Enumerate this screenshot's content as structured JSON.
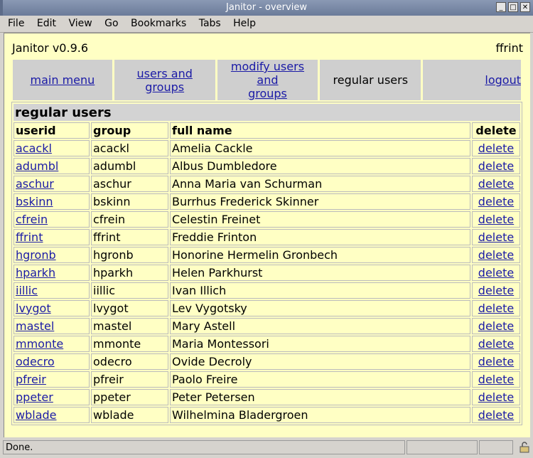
{
  "window": {
    "title": "Janitor - overview"
  },
  "menu": [
    "File",
    "Edit",
    "View",
    "Go",
    "Bookmarks",
    "Tabs",
    "Help"
  ],
  "app": {
    "name": "Janitor v0.9.6",
    "user": "ffrint"
  },
  "nav": {
    "main_menu": "main menu",
    "users_groups": "users and groups",
    "modify_line1": "modify users and",
    "modify_line2": "groups",
    "current": "regular users",
    "logout": "logout"
  },
  "table": {
    "title": "regular users",
    "headers": {
      "userid": "userid",
      "group": "group",
      "fullname": "full name",
      "delete": "delete"
    },
    "delete_label": "delete",
    "rows": [
      [
        "acackl",
        "acackl",
        "Amelia Cackle"
      ],
      [
        "adumbl",
        "adumbl",
        "Albus Dumbledore"
      ],
      [
        "aschur",
        "aschur",
        "Anna Maria van Schurman"
      ],
      [
        "bskinn",
        "bskinn",
        "Burrhus Frederick Skinner"
      ],
      [
        "cfrein",
        "cfrein",
        "Celestin Freinet"
      ],
      [
        "ffrint",
        "ffrint",
        "Freddie Frinton"
      ],
      [
        "hgronb",
        "hgronb",
        "Honorine Hermelin Gronbech"
      ],
      [
        "hparkh",
        "hparkh",
        "Helen Parkhurst"
      ],
      [
        "iillic",
        "iillic",
        "Ivan Illich"
      ],
      [
        "lvygot",
        "lvygot",
        "Lev Vygotsky"
      ],
      [
        "mastel",
        "mastel",
        "Mary Astell"
      ],
      [
        "mmonte",
        "mmonte",
        "Maria Montessori"
      ],
      [
        "odecro",
        "odecro",
        "Ovide Decroly"
      ],
      [
        "pfreir",
        "pfreir",
        "Paolo Freire"
      ],
      [
        "ppeter",
        "ppeter",
        "Peter Petersen"
      ],
      [
        "wblade",
        "wblade",
        "Wilhelmina Bladergroen"
      ]
    ]
  },
  "status": {
    "text": "Done."
  },
  "icons": {
    "window_buttons": [
      "minimize-icon",
      "maximize-icon",
      "close-icon"
    ],
    "status": "lock-icon"
  }
}
